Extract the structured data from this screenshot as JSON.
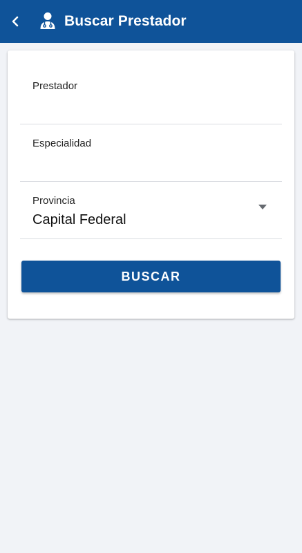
{
  "appbar": {
    "title": "Buscar Prestador",
    "back_icon": "chevron-left-icon",
    "title_icon": "doctor-icon",
    "background": "#0f5399"
  },
  "form": {
    "prestador": {
      "label": "Prestador",
      "value": ""
    },
    "especialidad": {
      "label": "Especialidad",
      "value": ""
    },
    "provincia": {
      "label": "Provincia",
      "value": "Capital Federal"
    },
    "submit_label": "BUSCAR"
  }
}
